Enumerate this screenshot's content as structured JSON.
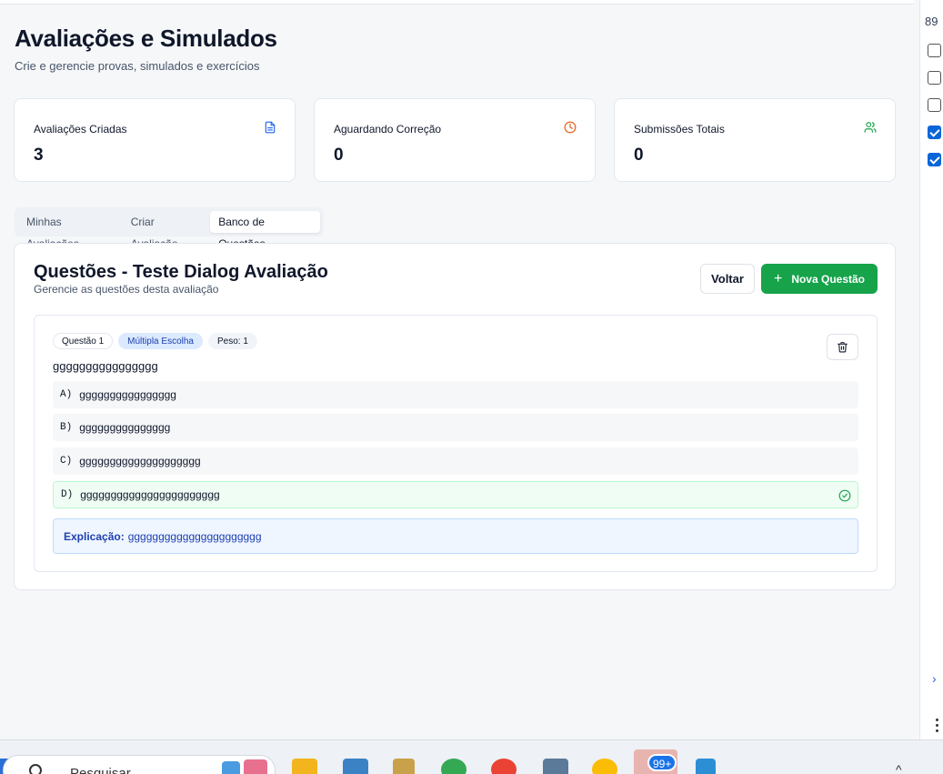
{
  "header": {
    "title": "Avaliações e Simulados",
    "subtitle": "Crie e gerencie provas, simulados e exercícios"
  },
  "stats": [
    {
      "label": "Avaliações Criadas",
      "value": "3",
      "icon": "file-text-icon",
      "icon_color": "#2563eb"
    },
    {
      "label": "Aguardando Correção",
      "value": "0",
      "icon": "clock-icon",
      "icon_color": "#ea580c"
    },
    {
      "label": "Submissões Totais",
      "value": "0",
      "icon": "users-icon",
      "icon_color": "#16a34a"
    }
  ],
  "tabs": [
    {
      "label": "Minhas Avaliações",
      "active": false
    },
    {
      "label": "Criar Avaliação",
      "active": false
    },
    {
      "label": "Banco de Questões",
      "active": true
    }
  ],
  "panel": {
    "title": "Questões - Teste Dialog Avaliação",
    "subtitle": "Gerencie as questões desta avaliação",
    "back_label": "Voltar",
    "new_label": "Nova Questão"
  },
  "question": {
    "number_badge": "Questão 1",
    "type_badge": "Múltipla Escolha",
    "weight_badge": "Peso: 1",
    "text": "gggggggggggggggg",
    "options": [
      {
        "letter": "A)",
        "text": "gggggggggggggggg",
        "correct": false
      },
      {
        "letter": "B)",
        "text": "ggggggggggggggg",
        "correct": false
      },
      {
        "letter": "C)",
        "text": "gggggggggggggggggggg",
        "correct": false
      },
      {
        "letter": "D)",
        "text": "ggggggggggggggggggggggg",
        "correct": true
      }
    ],
    "explanation_label": "Explicação:",
    "explanation_text": "gggggggggggggggggggggg"
  },
  "side_panel": {
    "number": "89",
    "checkboxes": [
      false,
      false,
      false,
      true,
      true
    ]
  },
  "taskbar": {
    "search_placeholder": "Pesquisar",
    "notification_count": "99+"
  },
  "colors": {
    "accent_green": "#16a34a",
    "accent_blue": "#2563eb",
    "page_bg": "#f6f7f9"
  }
}
